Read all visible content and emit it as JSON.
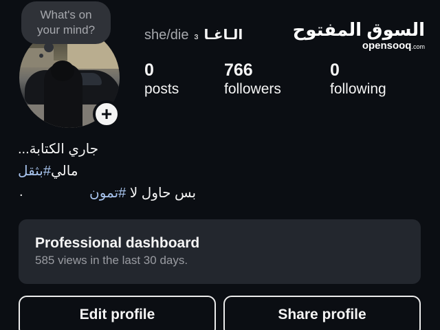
{
  "note": {
    "text": "What's on your mind?"
  },
  "profile": {
    "pronouns": "she/die",
    "name_mark": "ɜ",
    "display_name": "الـاغـا",
    "add_icon": "+"
  },
  "stats": [
    {
      "value": "0",
      "label": "posts"
    },
    {
      "value": "766",
      "label": "followers"
    },
    {
      "value": "0",
      "label": "following"
    }
  ],
  "logo": {
    "arabic": "السوق المفتوح",
    "latin": "opensooq",
    "suffix": ".com"
  },
  "bio": {
    "line1": "جاري الكتابة...",
    "line2_prefix": "مالي",
    "line2_tag": "#بثقل",
    "line3_prefix": "بس حاول لا ",
    "line3_tag": "#تمون",
    "dot": "."
  },
  "dashboard": {
    "title": "Professional dashboard",
    "subtitle": "585 views in the last 30 days."
  },
  "buttons": {
    "edit": "Edit profile",
    "share": "Share profile"
  },
  "colors": {
    "background": "#0b0e13",
    "hashtag": "#a8c4ee",
    "card": "#23272e"
  }
}
